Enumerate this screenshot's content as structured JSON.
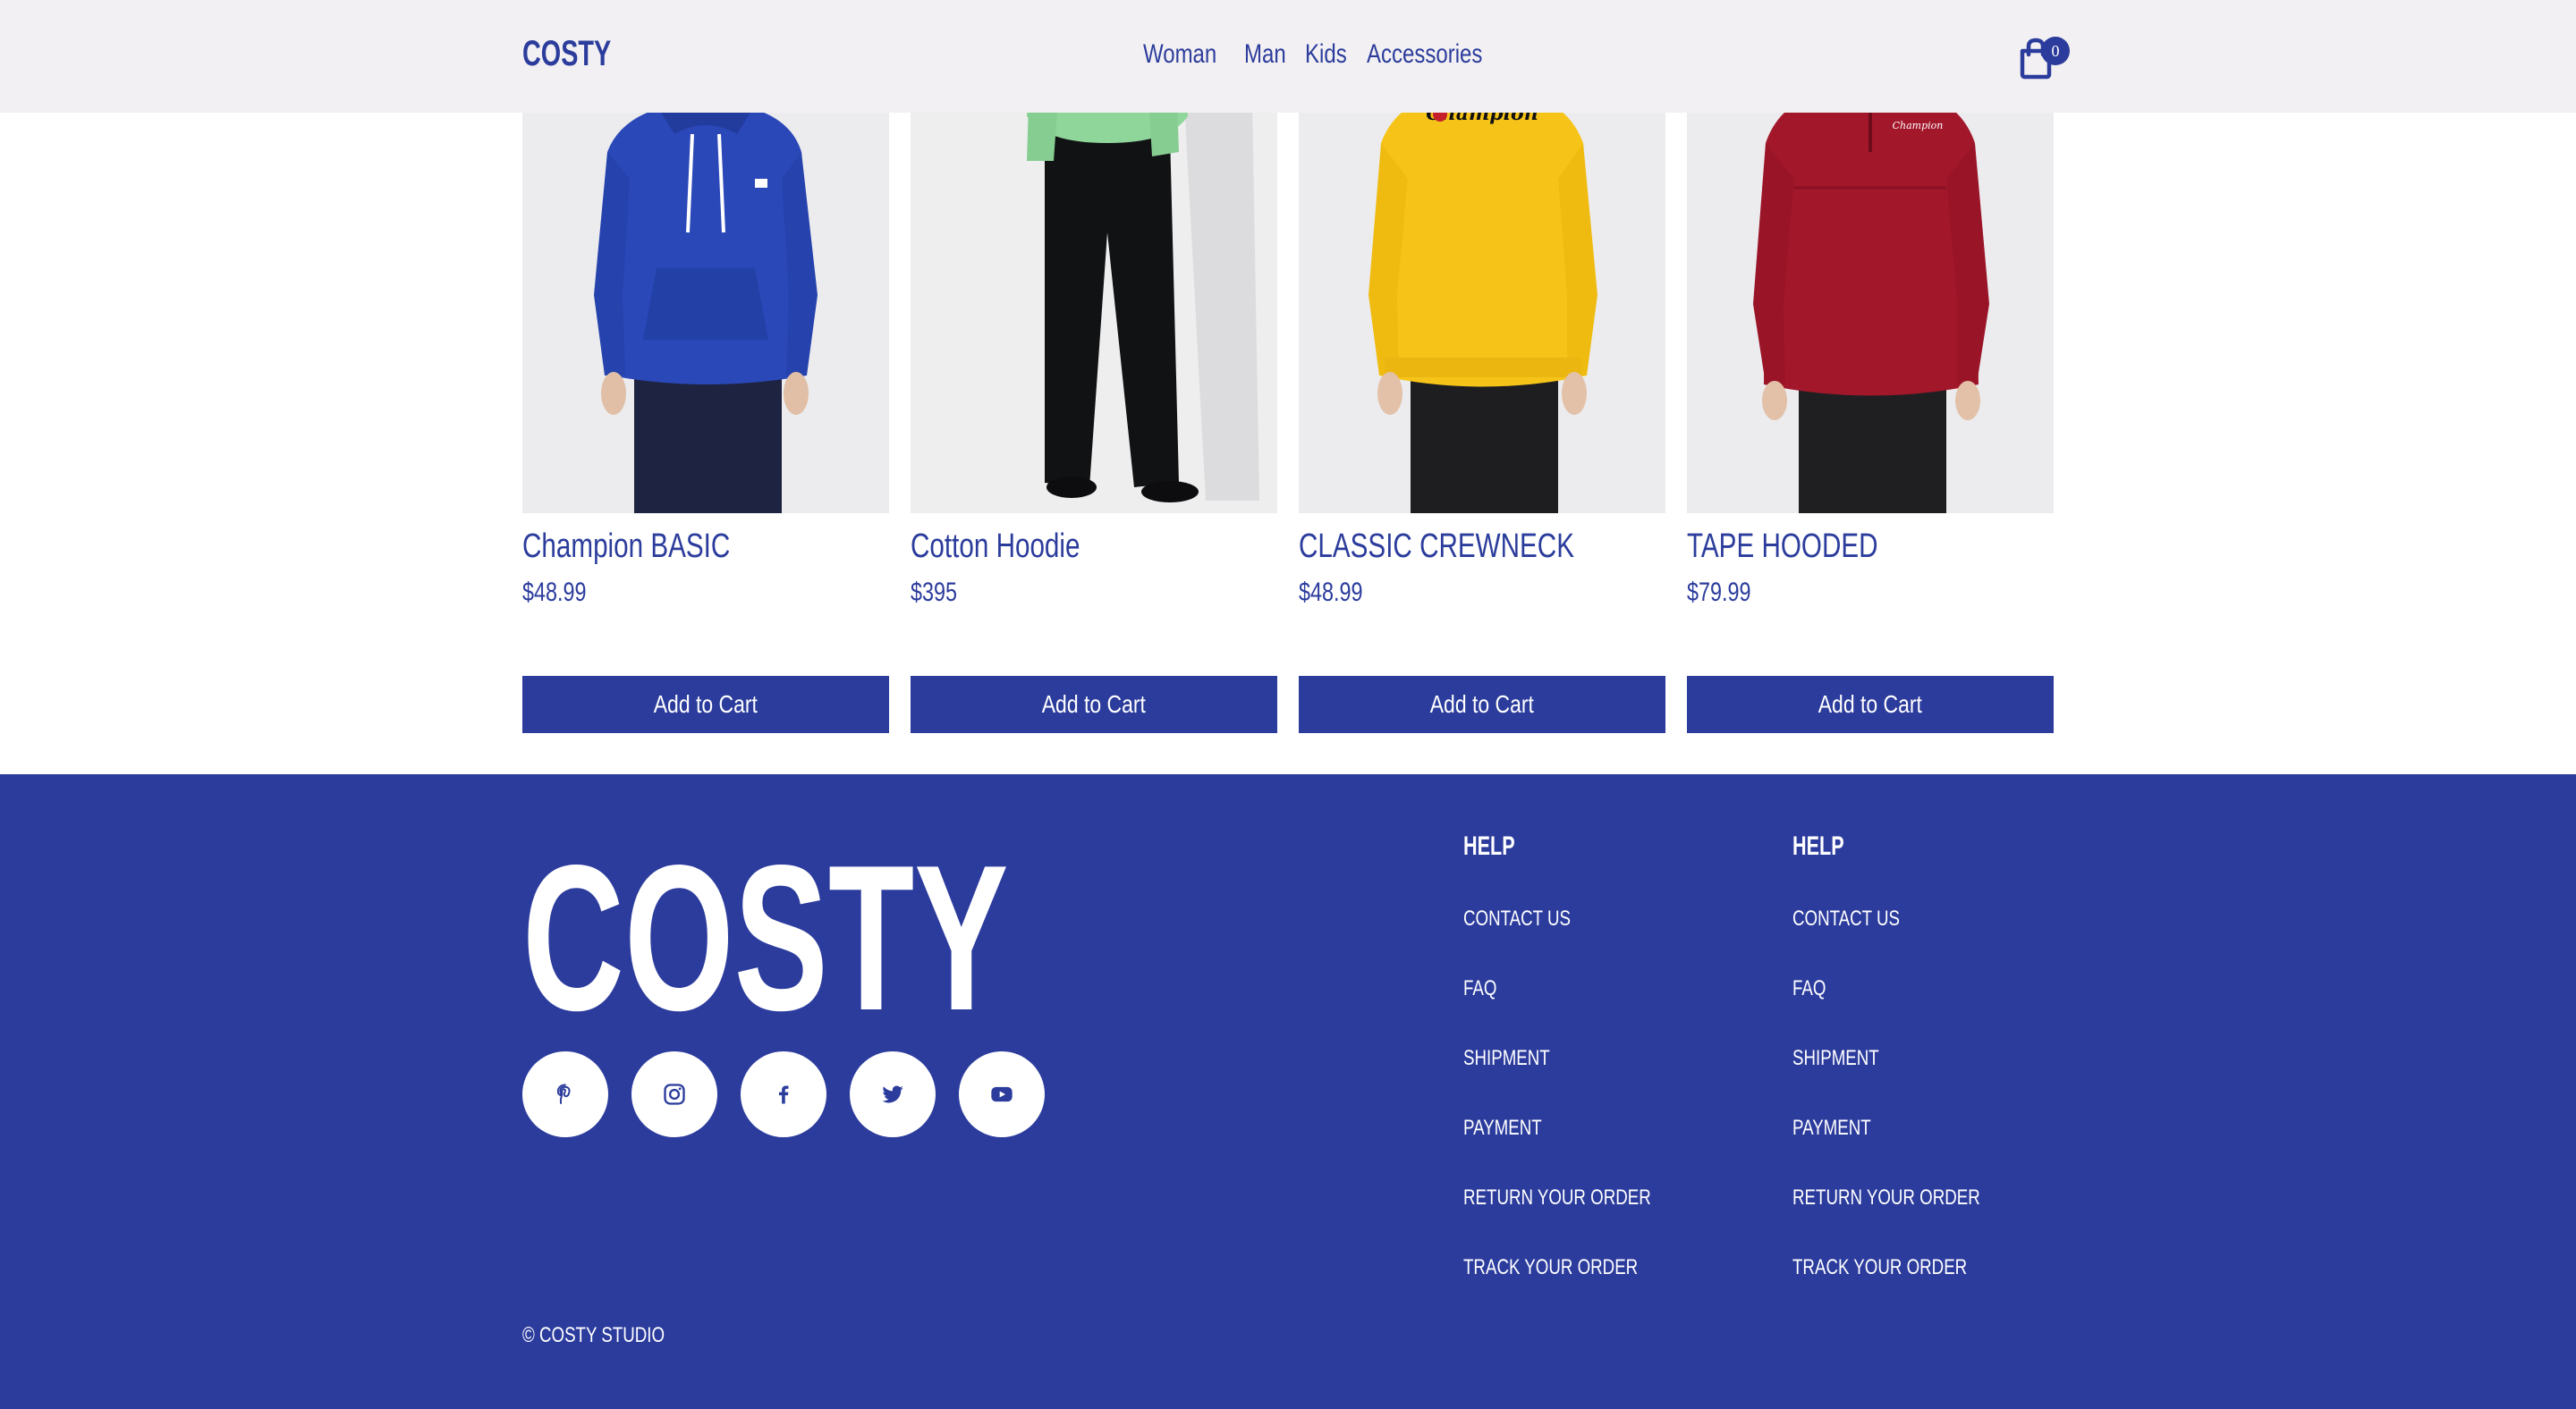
{
  "header": {
    "logo": "COSTY",
    "nav": [
      "Woman",
      "Man",
      "Kids",
      "Accessories"
    ],
    "cart_count": "0"
  },
  "products": [
    {
      "name": "Champion BASIC",
      "price": "$48.99",
      "button": "Add to Cart",
      "color": "#2a48b8"
    },
    {
      "name": "Cotton Hoodie",
      "price": "$395",
      "button": "Add to Cart",
      "color": "#8ed89a"
    },
    {
      "name": "CLASSIC CREWNECK",
      "price": "$48.99",
      "button": "Add to Cart",
      "color": "#f6c419"
    },
    {
      "name": "TAPE HOODED",
      "price": "$79.99",
      "button": "Add to Cart",
      "color": "#a3172b"
    }
  ],
  "footer": {
    "logo": "COSTY",
    "socials": [
      "pinterest-icon",
      "instagram-icon",
      "facebook-icon",
      "twitter-icon",
      "youtube-icon"
    ],
    "help_columns": [
      {
        "title": "HELP",
        "links": [
          "CONTACT US",
          "FAQ",
          "SHIPMENT",
          "PAYMENT",
          "RETURN YOUR ORDER",
          "TRACK YOUR ORDER"
        ]
      },
      {
        "title": "HELP",
        "links": [
          "CONTACT US",
          "FAQ",
          "SHIPMENT",
          "PAYMENT",
          "RETURN YOUR ORDER",
          "TRACK YOUR ORDER"
        ]
      }
    ],
    "copyright": "© COSTY STUDIO"
  },
  "colors": {
    "brand": "#2b3c9c",
    "header_bg": "#f2f0f2",
    "footer_bg": "#2c3c9d"
  }
}
